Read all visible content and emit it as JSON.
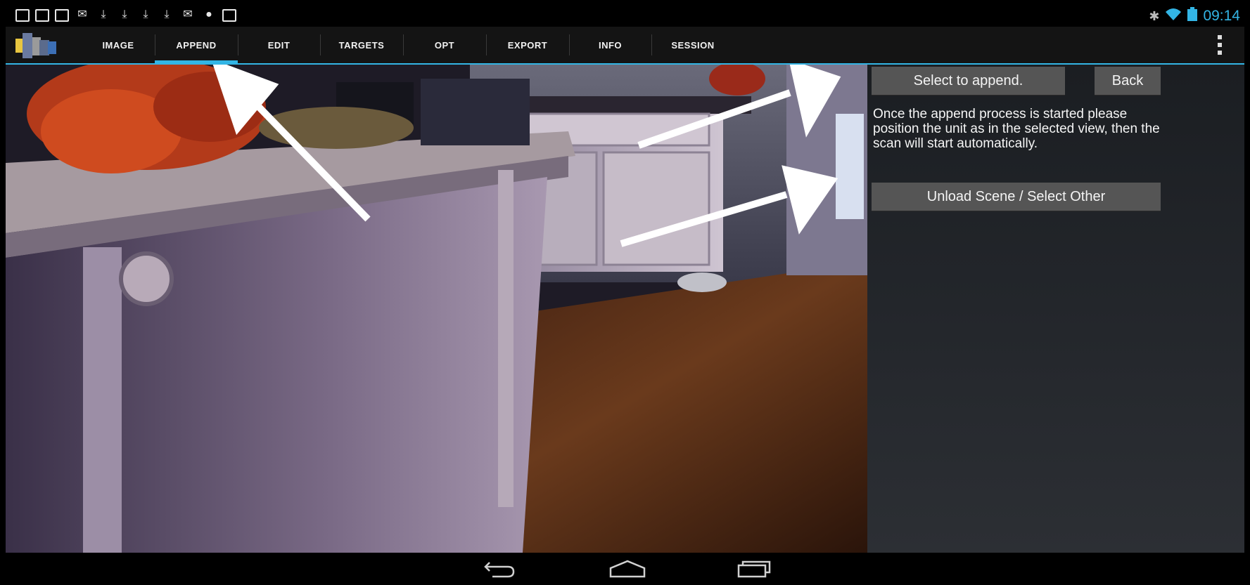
{
  "status_bar": {
    "left_icons": [
      "screen-icon",
      "sim-icon",
      "image-notification-icon",
      "mail-icon",
      "download-icon",
      "download-icon",
      "download-icon",
      "download-icon",
      "mail-icon",
      "cat-icon",
      "briefcase-icon"
    ],
    "time": "09:14",
    "accent": "#33b5e5"
  },
  "action_bar": {
    "tabs": [
      {
        "label": "IMAGE",
        "active": false
      },
      {
        "label": "APPEND",
        "active": true
      },
      {
        "label": "EDIT",
        "active": false
      },
      {
        "label": "TARGETS",
        "active": false
      },
      {
        "label": "OPT",
        "active": false
      },
      {
        "label": "EXPORT",
        "active": false
      },
      {
        "label": "INFO",
        "active": false
      },
      {
        "label": "SESSION",
        "active": false
      }
    ]
  },
  "panel": {
    "select_button": "Select to append.",
    "back_button": "Back",
    "info_text": "Once the append process is started please position the unit as in the selected view, then the scan will start automatically.",
    "unload_button": "Unload Scene / Select Other"
  },
  "nav_bar": {
    "icons": [
      "back-icon",
      "home-icon",
      "recents-icon"
    ]
  }
}
